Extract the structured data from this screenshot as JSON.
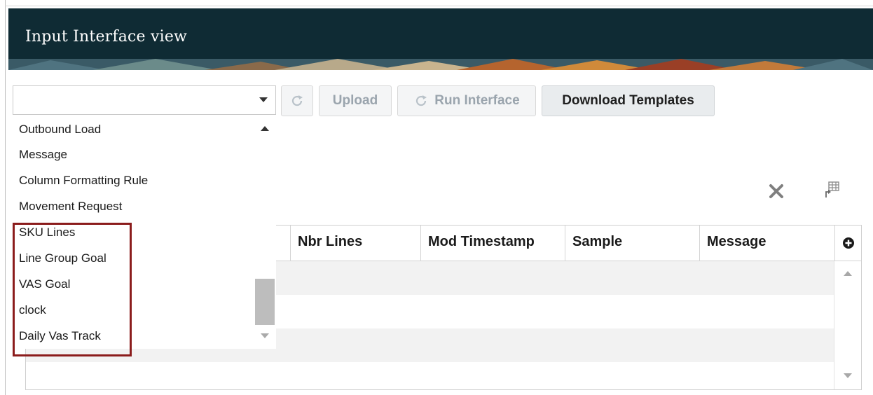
{
  "header": {
    "title": "Input Interface view"
  },
  "toolbar": {
    "combo_value": "",
    "upload_label": "Upload",
    "run_interface_label": "Run Interface",
    "download_templates_label": "Download Templates"
  },
  "dropdown": {
    "items": [
      "Outbound Load",
      "Message",
      "Column Formatting Rule",
      "Movement Request",
      "SKU Lines",
      "Line Group Goal",
      "VAS Goal",
      "clock",
      "Daily Vas Track"
    ]
  },
  "grid": {
    "columns": [
      "Nbr Lines",
      "Mod Timestamp",
      "Sample",
      "Message"
    ]
  },
  "icons": {
    "combo_arrow": "caret-down-icon",
    "refresh": "refresh-icon",
    "clear": "close-icon",
    "export": "export-grid-icon",
    "add_column": "add-circle-icon",
    "scroll_up": "scroll-up-icon",
    "scroll_down": "scroll-down-icon"
  },
  "colors": {
    "header_bg": "#0f2b34",
    "highlight_border": "#8b1c1c"
  }
}
